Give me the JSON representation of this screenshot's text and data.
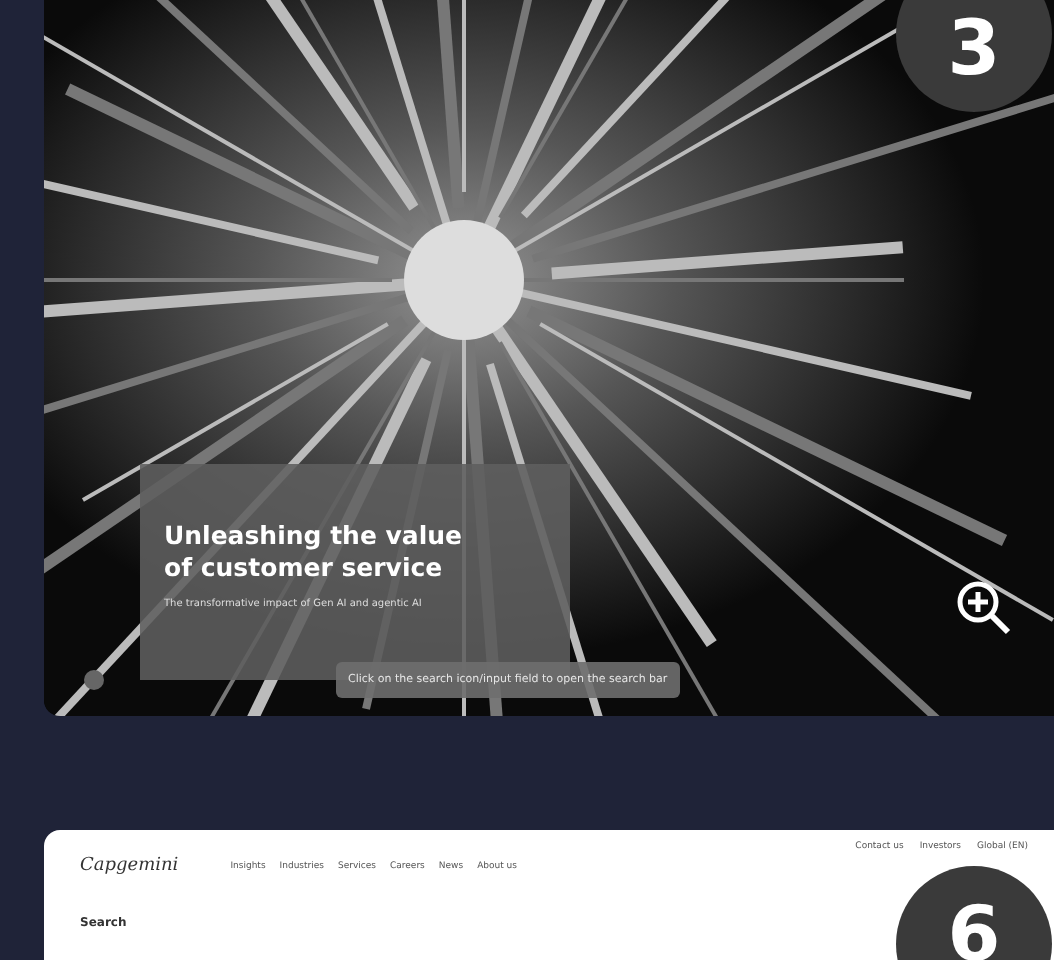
{
  "slides": [
    {
      "kind": "hero",
      "badge": "3",
      "hero": {
        "title": "Unleashing the value of customer service",
        "subtitle": "The transformative impact of Gen AI and agentic AI"
      },
      "tooltip": "Click on the search icon/input field to open the search bar"
    },
    {
      "kind": "site",
      "badge": "6",
      "logo": "Capgemini",
      "nav": [
        "Insights",
        "Industries",
        "Services",
        "Careers",
        "News",
        "About us"
      ],
      "utility_links": [
        "Contact us",
        "Investors",
        "Global (EN)"
      ],
      "heading": "Search"
    }
  ]
}
